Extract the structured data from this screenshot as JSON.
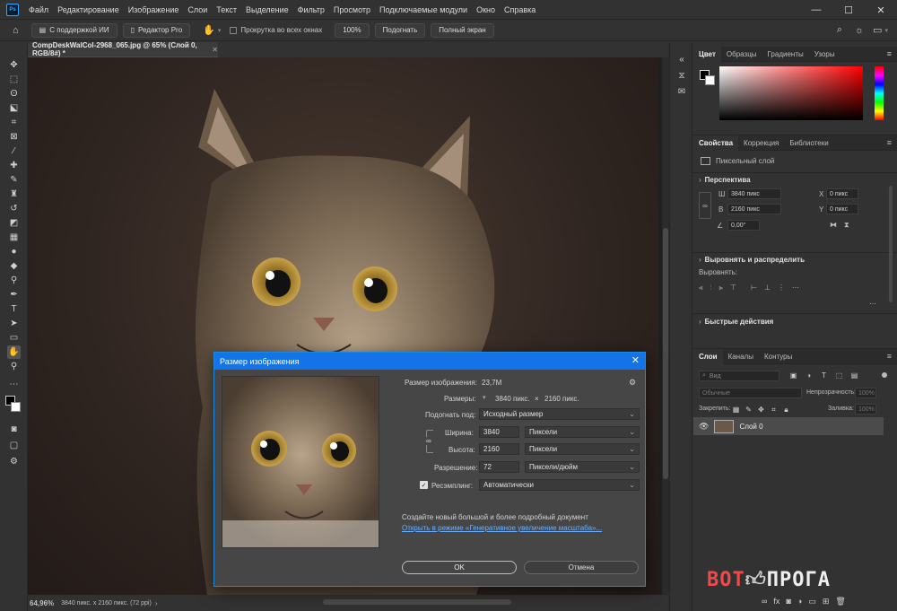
{
  "menubar": {
    "items": [
      "Файл",
      "Редактирование",
      "Изображение",
      "Слои",
      "Текст",
      "Выделение",
      "Фильтр",
      "Просмотр",
      "Подключаемые модули",
      "Окно",
      "Справка"
    ]
  },
  "optionsbar": {
    "ai_support": "С поддержкой ИИ",
    "editor_pro": "Редактор Pro",
    "scroll_all": "Прокрутка во всех окнах",
    "zoom_100": "100%",
    "fit": "Подогнать",
    "fullscreen": "Полный экран"
  },
  "document": {
    "tab_title": "CompDeskWalCol-2968_065.jpg @ 65% (Слой 0, RGB/8#) *",
    "zoom": "64,96%",
    "info": "3840 пикс. x 2160 пикс. (72 ppi)"
  },
  "color_panel": {
    "tabs": [
      "Цвет",
      "Образцы",
      "Градиенты",
      "Узоры"
    ],
    "foreground": "#000000",
    "background": "#ffffff"
  },
  "properties_panel": {
    "tabs": [
      "Свойства",
      "Коррекция",
      "Библиотеки"
    ],
    "layer_type": "Пиксельный слой",
    "perspective_title": "Перспектива",
    "w_label": "Ш",
    "w_value": "3840 пикс",
    "h_label": "В",
    "h_value": "2160 пикс",
    "x_label": "X",
    "x_value": "0 пикс",
    "y_label": "Y",
    "y_value": "0 пикс",
    "angle": "0,00°",
    "align_title": "Выровнять и распределить",
    "align_label": "Выровнять:",
    "quick_actions": "Быстрые действия"
  },
  "layers_panel": {
    "tabs": [
      "Слои",
      "Каналы",
      "Контуры"
    ],
    "search_placeholder": "Вид",
    "blend_mode": "Обычные",
    "opacity_label": "Непрозрачность:",
    "opacity_value": "100%",
    "lock_label": "Закрепить:",
    "fill_label": "Заливка:",
    "fill_value": "100%",
    "layer_name": "Слой 0"
  },
  "dialog": {
    "title": "Размер изображения",
    "image_size_label": "Размер изображения:",
    "image_size_value": "23,7M",
    "dimensions_label": "Размеры:",
    "dimensions_w": "3840 пикс.",
    "dimensions_x": "×",
    "dimensions_h": "2160 пикс.",
    "fit_label": "Подогнать под:",
    "fit_value": "Исходный размер",
    "width_label": "Ширина:",
    "width_value": "3840",
    "width_unit": "Пиксели",
    "height_label": "Высота:",
    "height_value": "2160",
    "height_unit": "Пиксели",
    "resolution_label": "Разрешение:",
    "resolution_value": "72",
    "resolution_unit": "Пиксели/дюйм",
    "resample_label": "Ресэмплинг:",
    "resample_value": "Автоматически",
    "promo_text": "Создайте новый большой и более подробный документ",
    "promo_link": "Открыть в режиме «Генеративное увеличение масштаба»...",
    "ok": "OK",
    "cancel": "Отмена"
  },
  "watermark": {
    "part1": "BOT",
    "part2": "ПРОГА"
  }
}
